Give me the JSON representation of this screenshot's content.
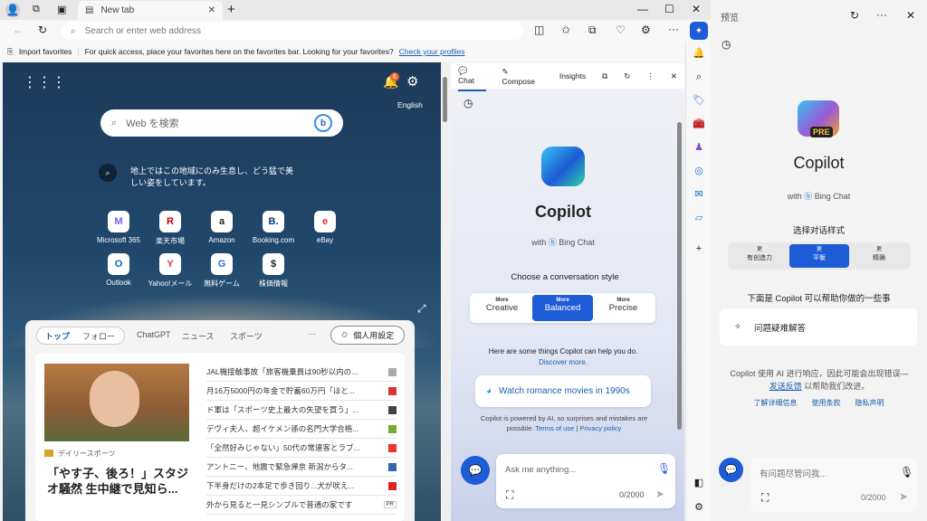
{
  "browser": {
    "tab_title": "New tab",
    "address_placeholder": "Search or enter web address",
    "favorites_bar": {
      "import": "Import favorites",
      "message": "For quick access, place your favorites here on the favorites bar. Looking for your favorites?",
      "link": "Check your profiles"
    }
  },
  "ntp": {
    "notification_count": "6",
    "language": "English",
    "search_placeholder": "Web を検索",
    "fact": "地上ではこの地域にのみ生息し、どう猛で美しい姿をしています。",
    "tiles": [
      {
        "label": "Microsoft 365",
        "icon": "M"
      },
      {
        "label": "楽天市場",
        "icon": "R"
      },
      {
        "label": "Amazon",
        "icon": "a"
      },
      {
        "label": "Booking.com",
        "icon": "B."
      },
      {
        "label": "eBay",
        "icon": "e"
      },
      {
        "label": "Outlook",
        "icon": "O"
      },
      {
        "label": "Yahoo!メール",
        "icon": "Y"
      },
      {
        "label": "無料ゲーム",
        "icon": "G"
      },
      {
        "label": "株価情報",
        "icon": "$"
      }
    ],
    "feed_tabs": [
      "トップ",
      "フォロー",
      "ChatGPT",
      "ニュース",
      "スポーツ"
    ],
    "more": "···",
    "personalize": "個人用設定",
    "hero": {
      "source": "デイリースポーツ",
      "title": "「やす子、後ろ！」スタジオ騒然 生中継で見知ら..."
    },
    "news": [
      "JAL機接触事故「旅客機乗員は90秒以内の...",
      "月16万5000円の年金で貯蓄60万円「ほと...",
      "ド軍は「スポーツ史上最大の失望を買う」...",
      "デヴィ夫人、超イケメン孫の名門大学合格...",
      "「全然好みじゃない」50代の常連客とラブ...",
      "アントニー、地震で緊急帰京 新潟からタ...",
      "下半身だけの2本足で歩き回り...犬が吠え...",
      "外から見ると一見シンプルで普通の家です"
    ],
    "news_badge_last": "PR"
  },
  "copilot": {
    "tabs": [
      "Chat",
      "Compose",
      "Insights"
    ],
    "title": "Copilot",
    "with": "with",
    "bing_chat": "Bing Chat",
    "choose_style": "Choose a conversation style",
    "styles": [
      {
        "more": "More",
        "name": "Creative"
      },
      {
        "more": "More",
        "name": "Balanced"
      },
      {
        "more": "More",
        "name": "Precise"
      }
    ],
    "help_text": "Here are some things Copilot can help you do.",
    "discover": "Discover more.",
    "suggestion": "Watch romance movies in 1990s",
    "disclaimer": "Copilot is powered by AI, so surprises and mistakes are possible.",
    "terms": "Terms of use",
    "sep": "|",
    "privacy": "Privacy policy",
    "input_placeholder": "Ask me anything...",
    "counter": "0/2000"
  },
  "preview": {
    "title": "预览",
    "badge": "PRE",
    "name": "Copilot",
    "with": "with",
    "bing_chat": "Bing Chat",
    "choose_style": "选择对话样式",
    "styles": [
      {
        "more": "更",
        "name": "有创造力"
      },
      {
        "more": "更",
        "name": "平衡"
      },
      {
        "more": "更",
        "name": "精确"
      }
    ],
    "help_text": "下面是 Copilot 可以帮助你做的一些事",
    "suggestion": "问题疑难解答",
    "disclaimer": "Copilot 使用 AI 进行响应，因此可能会出现错误—",
    "feedback": "发送反馈",
    "disclaimer2": "以帮助我们改进。",
    "links": [
      "了解详细信息",
      "使用条款",
      "隐私声明"
    ],
    "input_placeholder": "有问题尽管问我...",
    "counter": "0/2000"
  },
  "colors": {
    "accent": "#1e5bd6",
    "link": "#1a5fb4"
  }
}
